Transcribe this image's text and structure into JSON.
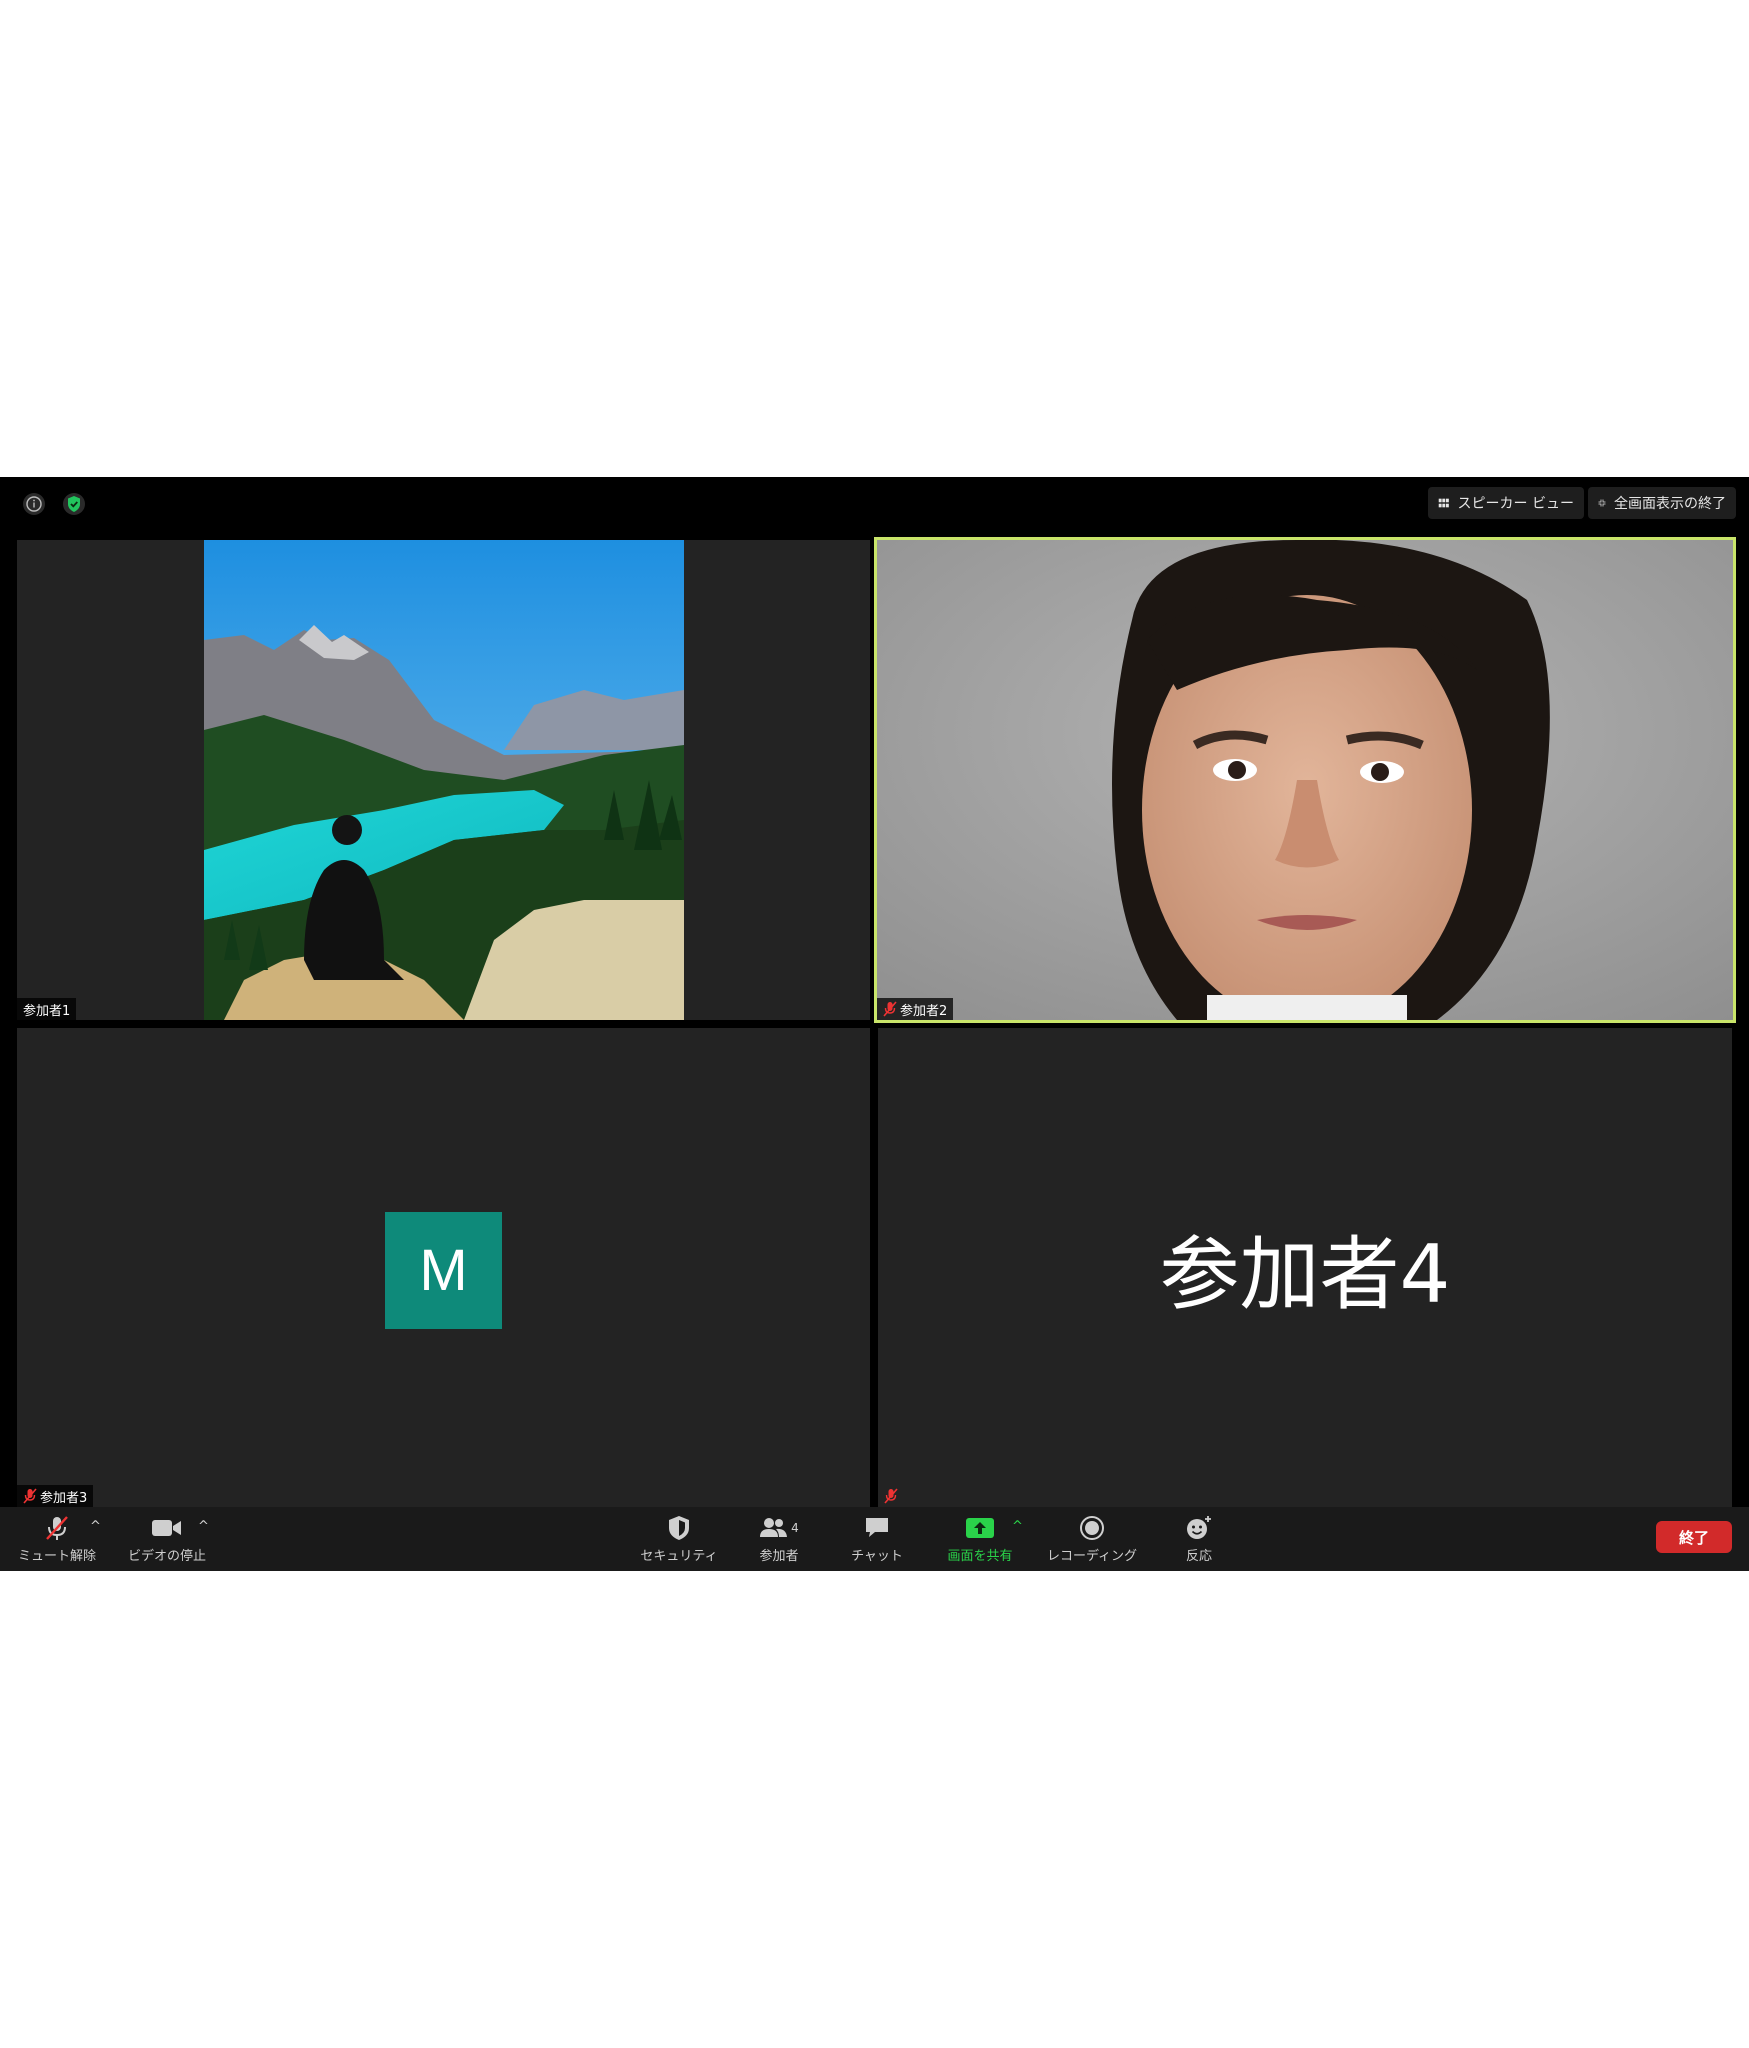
{
  "topbar": {
    "info_icon": "info-icon",
    "shield_icon": "shield-check-icon",
    "speaker_view_label": "スピーカー ビュー",
    "exit_fullscreen_label": "全画面表示の終了"
  },
  "participants": [
    {
      "name": "参加者1",
      "muted": false,
      "video": "landscape-photo"
    },
    {
      "name": "参加者2",
      "muted": true,
      "video": "portrait-photo",
      "active_speaker": true
    },
    {
      "name": "参加者3",
      "muted": true,
      "avatar_letter": "M"
    },
    {
      "name": "",
      "muted": true,
      "display_name": "参加者4"
    }
  ],
  "toolbar": {
    "unmute_label": "ミュート解除",
    "stop_video_label": "ビデオの停止",
    "security_label": "セキュリティ",
    "participants_label": "参加者",
    "participants_count": "4",
    "chat_label": "チャット",
    "share_screen_label": "画面を共有",
    "recording_label": "レコーディング",
    "reactions_label": "反応",
    "end_label": "終了"
  },
  "colors": {
    "active_speaker_border": "#c9e56a",
    "share_green": "#2ad34a",
    "end_red": "#d22a2a",
    "avatar_teal": "#0e8a7a"
  }
}
